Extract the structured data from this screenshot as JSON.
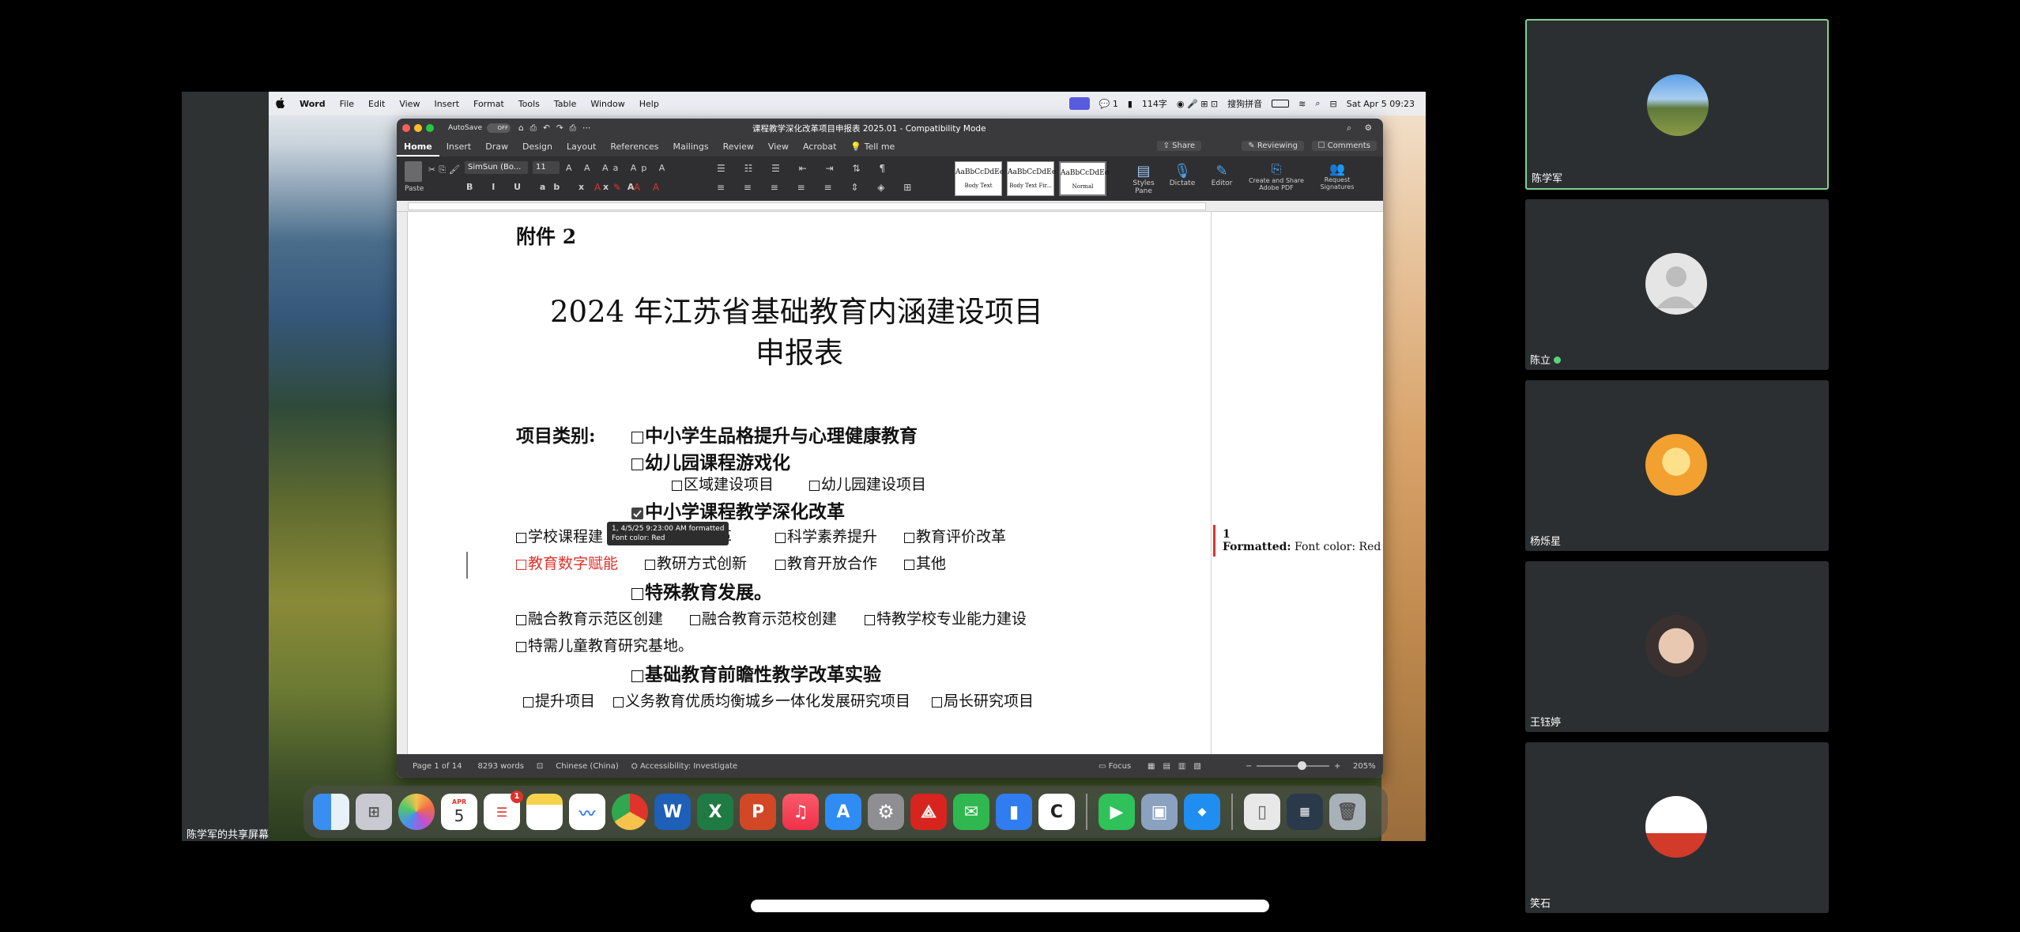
{
  "share_label": "陈学军的共享屏幕",
  "menubar": {
    "apple": "",
    "app": "Word",
    "items": [
      "File",
      "Edit",
      "View",
      "Insert",
      "Format",
      "Tools",
      "Table",
      "Window",
      "Help"
    ],
    "status_count": "1",
    "speed": "114字",
    "ime": "搜狗拼音",
    "datetime": "Sat Apr 5  09:23"
  },
  "word": {
    "autosave_label": "AutoSave",
    "autosave_state": "OFF",
    "title": "课程教学深化改革项目申报表 2025.01  -  Compatibility Mode",
    "tabs": [
      "Home",
      "Insert",
      "Draw",
      "Design",
      "Layout",
      "References",
      "Mailings",
      "Review",
      "View",
      "Acrobat"
    ],
    "tell_me": "Tell me",
    "share": "Share",
    "reviewing": "Reviewing",
    "comments": "Comments",
    "ribbon": {
      "paste": "Paste",
      "font": "SimSun (Bo...",
      "size": "11",
      "styles": [
        {
          "preview": "AaBbCcDdEe",
          "name": "Body Text"
        },
        {
          "preview": "AaBbCcDdEe",
          "name": "Body Text Fir..."
        },
        {
          "preview": "AaBbCcDdEe",
          "name": "Normal"
        }
      ],
      "styles_pane": "Styles Pane",
      "dictate": "Dictate",
      "editor": "Editor",
      "create_pdf": "Create and Share Adobe PDF",
      "request_sig": "Request Signatures"
    },
    "status": {
      "page": "Page 1 of 14",
      "words": "8293 words",
      "language": "Chinese (China)",
      "accessibility": "Accessibility: Investigate",
      "focus": "Focus",
      "zoom": "205%"
    }
  },
  "doc": {
    "attachment": "附件 2",
    "title_line1": "2024 年江苏省基础教育内涵建设项目",
    "title_line2": "申报表",
    "category_label": "项目类别:",
    "cat1": "中小学生品格提升与心理健康教育",
    "cat2": "幼儿园课程游戏化",
    "cat2_sub": [
      "区域建设项目",
      "幼儿园建设项目"
    ],
    "cat3": "中小学课程教学深化改革",
    "cat3_row1": [
      "学校课程建",
      "改革",
      "科学素养提升",
      "教育评价改革"
    ],
    "cat3_row2": [
      "教育数字赋能",
      "教研方式创新",
      "教育开放合作",
      "其他"
    ],
    "cat4": "特殊教育发展。",
    "cat4_row1": [
      "融合教育示范区创建",
      "融合教育示范校创建",
      "特教学校专业能力建设"
    ],
    "cat4_row2": "特需儿童教育研究基地。",
    "cat5": "基础教育前瞻性教学改革实验",
    "cat5_row": [
      "提升项目",
      "义务教育优质均衡城乡一体化发展研究项目",
      "局长研究项目"
    ],
    "tooltip_line1": "1, 4/5/25 9:23:00 AM formatted",
    "tooltip_line2": "Font color: Red",
    "revision_number": "1",
    "revision_label": "Formatted:",
    "revision_text": "Font color: Red"
  },
  "dock": {
    "calendar_month": "APR",
    "calendar_day": "5",
    "reminders_badge": "1"
  },
  "participants": [
    {
      "name": "陈学军",
      "active": true
    },
    {
      "name": "陈立",
      "active": false
    },
    {
      "name": "杨烁星",
      "active": false
    },
    {
      "name": "王钰婷",
      "active": false
    },
    {
      "name": "笑石",
      "active": false
    }
  ],
  "colors": {
    "revision_red": "#e0332b",
    "active_tile_border": "#7fd28f"
  }
}
